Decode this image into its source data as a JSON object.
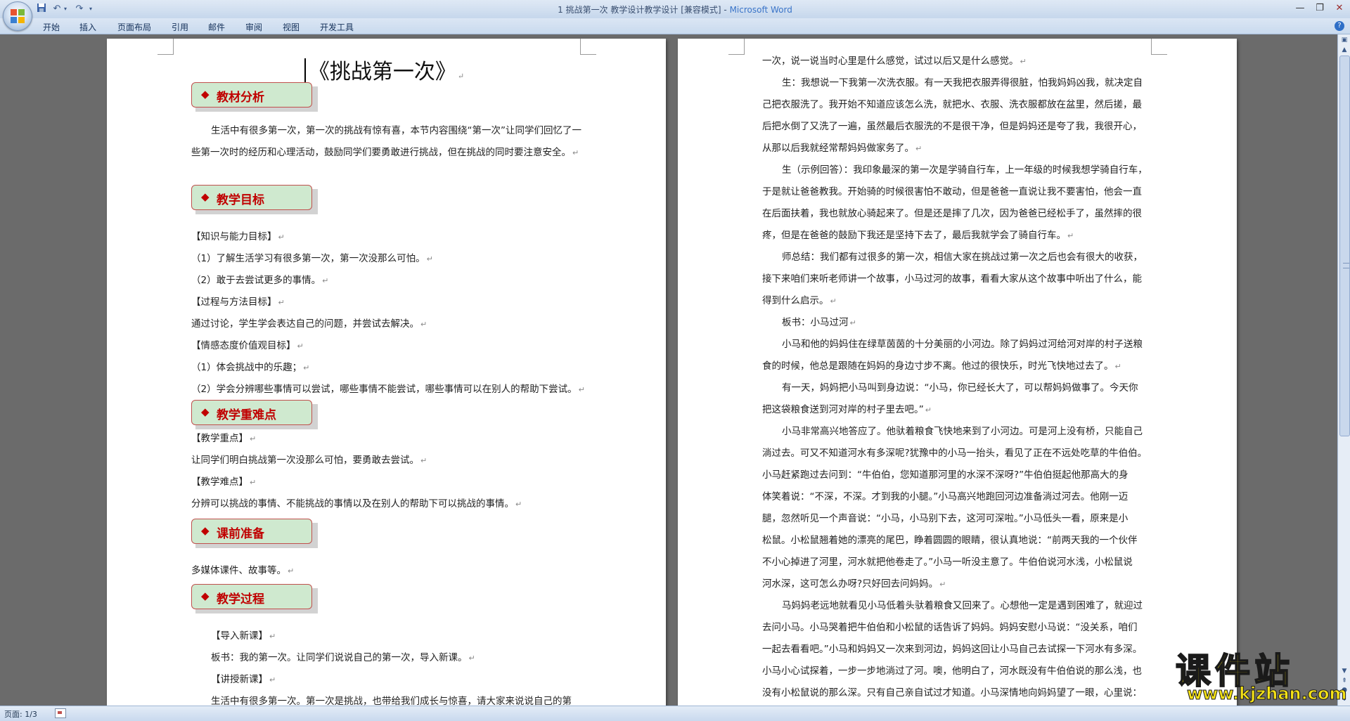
{
  "window": {
    "title_doc": "1 挑战第一次 教学设计教学设计 [兼容模式] - ",
    "title_app": "Microsoft Word"
  },
  "ribbon": {
    "tabs": [
      "开始",
      "插入",
      "页面布局",
      "引用",
      "邮件",
      "审阅",
      "视图",
      "开发工具"
    ]
  },
  "page1": {
    "title": "《挑战第一次》",
    "sections": {
      "s1": "教材分析",
      "s2": "教学目标",
      "s3": "教学重难点",
      "s4": "课前准备",
      "s5": "教学过程"
    },
    "analysis": "生活中有很多第一次，第一次的挑战有惊有喜，本节内容围绕“第一次”让同学们回忆了一些第一次时的经历和心理活动，鼓励同学们要勇敢进行挑战，但在挑战的同时要注意安全。",
    "goals": [
      "【知识与能力目标】",
      "（1）了解生活学习有很多第一次，第一次没那么可怕。",
      "（2）敢于去尝试更多的事情。",
      "【过程与方法目标】",
      "通过讨论，学生学会表达自己的问题，并尝试去解决。",
      "【情感态度价值观目标】",
      "（1）体会挑战中的乐趣；",
      "（2）学会分辨哪些事情可以尝试，哪些事情不能尝试，哪些事情可以在别人的帮助下尝试。"
    ],
    "keypoints": [
      "【教学重点】",
      "让同学们明白挑战第一次没那么可怕，要勇敢去尝试。",
      "【教学难点】",
      "分辨可以挑战的事情、不能挑战的事情以及在别人的帮助下可以挑战的事情。"
    ],
    "prep": "多媒体课件、故事等。",
    "process": [
      "【导入新课】",
      "板书：我的第一次。让同学们说说自己的第一次，导入新课。",
      "【讲授新课】",
      "生活中有很多第一次。第一次是挑战，也带给我们成长与惊喜，请大家来说说自己的第"
    ]
  },
  "page2": {
    "lines": [
      "一次，说一说当时心里是什么感觉，试过以后又是什么感觉。",
      "生：我想说一下我第一次洗衣服。有一天我把衣服弄得很脏，怕我妈妈凶我，就决定自",
      "己把衣服洗了。我开始不知道应该怎么洗，就把水、衣服、洗衣服都放在盆里，然后搓，最",
      "后把水倒了又洗了一遍，虽然最后衣服洗的不是很干净，但是妈妈还是夸了我，我很开心，",
      "从那以后我就经常帮妈妈做家务了。",
      "生（示例回答）：我印象最深的第一次是学骑自行车，上一年级的时候我想学骑自行车，",
      "于是就让爸爸教我。开始骑的时候很害怕不敢动，但是爸爸一直说让我不要害怕，他会一直",
      "在后面扶着，我也就放心骑起来了。但是还是摔了几次，因为爸爸已经松手了，虽然摔的很",
      "疼，但是在爸爸的鼓励下我还是坚持下去了，最后我就学会了骑自行车。",
      "师总结：我们都有过很多的第一次，相信大家在挑战过第一次之后也会有很大的收获，",
      "接下来咱们来听老师讲一个故事，小马过河的故事，看看大家从这个故事中听出了什么，能",
      "得到什么启示。",
      "板书：小马过河",
      "小马和他的妈妈住在绿草茵茵的十分美丽的小河边。除了妈妈过河给河对岸的村子送粮",
      "食的时候，他总是跟随在妈妈的身边寸步不离。他过的很快乐，时光飞快地过去了。",
      "有一天，妈妈把小马叫到身边说：“小马，你已经长大了，可以帮妈妈做事了。今天你",
      "把这袋粮食送到河对岸的村子里去吧。”",
      "小马非常高兴地答应了。他驮着粮食飞快地来到了小河边。可是河上没有桥，只能自己",
      "淌过去。可又不知道河水有多深呢?犹豫中的小马一抬头，看见了正在不远处吃草的牛伯伯。",
      "小马赶紧跑过去问到：“牛伯伯，您知道那河里的水深不深呀?”牛伯伯挺起他那高大的身",
      "体笑着说：“不深，不深。才到我的小腿。”小马高兴地跑回河边准备淌过河去。他刚一迈",
      "腿，忽然听见一个声音说：“小马，小马别下去，这河可深啦。”小马低头一看，原来是小",
      "松鼠。小松鼠翘着她的漂亮的尾巴，睁着圆圆的眼睛，很认真地说：“前两天我的一个伙伴",
      "不小心掉进了河里，河水就把他卷走了。”小马一听没主意了。牛伯伯说河水浅，小松鼠说",
      "河水深，这可怎么办呀?只好回去问妈妈。",
      "马妈妈老远地就看见小马低着头驮着粮食又回来了。心想他一定是遇到困难了，就迎过",
      "去问小马。小马哭着把牛伯伯和小松鼠的话告诉了妈妈。妈妈安慰小马说：“没关系，咱们",
      "一起去看看吧。”小马和妈妈又一次来到河边，妈妈这回让小马自己去试探一下河水有多深。",
      "小马小心试探着，一步一步地淌过了河。噢，他明白了，河水既没有牛伯伯说的那么浅，也",
      "没有小松鼠说的那么深。只有自己亲自试过才知道。小马深情地向妈妈望了一眼，心里说："
    ]
  },
  "status": {
    "page_count": "页面: 1/3"
  },
  "watermark": {
    "title": "课件站",
    "url": "www.kjzhan.com"
  },
  "colors": {
    "section_fill": "#cfe9cf",
    "section_text": "#c00000",
    "section_border": "#c0504d"
  }
}
